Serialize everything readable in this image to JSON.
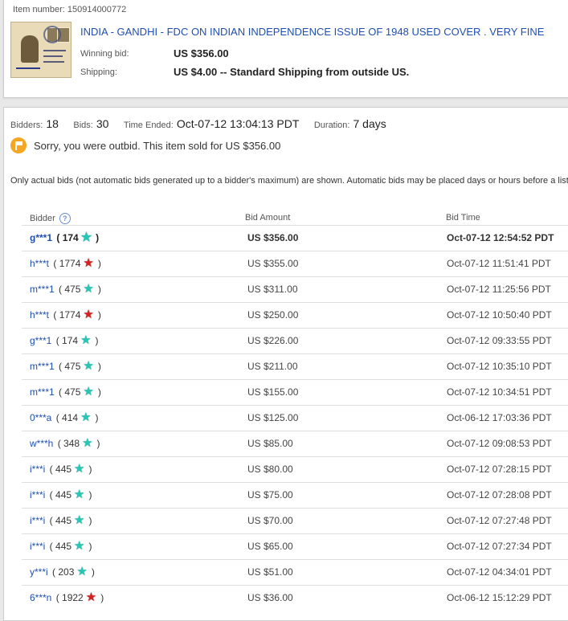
{
  "item": {
    "number_label": "Item number: 150914000772",
    "title": "INDIA - GANDHI - FDC ON INDIAN INDEPENDENCE ISSUE OF 1948 USED COVER . VERY FINE",
    "winning_bid_label": "Winning bid:",
    "winning_bid_value": "US $356.00",
    "shipping_label": "Shipping:",
    "shipping_value": "US $4.00 -- Standard Shipping from outside US."
  },
  "stats": {
    "bidders_label": "Bidders:",
    "bidders_value": "18",
    "bids_label": "Bids:",
    "bids_value": "30",
    "time_ended_label": "Time Ended:",
    "time_ended_value": "Oct-07-12 13:04:13 PDT",
    "duration_label": "Duration:",
    "duration_value": "7 days"
  },
  "alert": {
    "icon": "flag-icon",
    "color": "#f5a623",
    "text": "Sorry, you were outbid. This item sold for US $356.00"
  },
  "note": "Only actual bids (not automatic bids generated up to a bidder's maximum) are shown. Automatic bids may be placed days or hours before a listin",
  "table": {
    "headers": {
      "bidder": "Bidder",
      "amount": "Bid Amount",
      "time": "Bid Time"
    },
    "rows": [
      {
        "bidder": "g***1",
        "score": "174",
        "star": "teal",
        "amount": "US $356.00",
        "time": "Oct-07-12 12:54:52 PDT",
        "winner": true
      },
      {
        "bidder": "h***t",
        "score": "1774",
        "star": "red",
        "amount": "US $355.00",
        "time": "Oct-07-12 11:51:41 PDT"
      },
      {
        "bidder": "m***1",
        "score": "475",
        "star": "teal",
        "amount": "US $311.00",
        "time": "Oct-07-12 11:25:56 PDT"
      },
      {
        "bidder": "h***t",
        "score": "1774",
        "star": "red",
        "amount": "US $250.00",
        "time": "Oct-07-12 10:50:40 PDT"
      },
      {
        "bidder": "g***1",
        "score": "174",
        "star": "teal",
        "amount": "US $226.00",
        "time": "Oct-07-12 09:33:55 PDT"
      },
      {
        "bidder": "m***1",
        "score": "475",
        "star": "teal",
        "amount": "US $211.00",
        "time": "Oct-07-12 10:35:10 PDT"
      },
      {
        "bidder": "m***1",
        "score": "475",
        "star": "teal",
        "amount": "US $155.00",
        "time": "Oct-07-12 10:34:51 PDT"
      },
      {
        "bidder": "0***a",
        "score": "414",
        "star": "teal",
        "amount": "US $125.00",
        "time": "Oct-06-12 17:03:36 PDT"
      },
      {
        "bidder": "w***h",
        "score": "348",
        "star": "teal",
        "amount": "US $85.00",
        "time": "Oct-07-12 09:08:53 PDT"
      },
      {
        "bidder": "i***i",
        "score": "445",
        "star": "teal",
        "amount": "US $80.00",
        "time": "Oct-07-12 07:28:15 PDT"
      },
      {
        "bidder": "i***i",
        "score": "445",
        "star": "teal",
        "amount": "US $75.00",
        "time": "Oct-07-12 07:28:08 PDT"
      },
      {
        "bidder": "i***i",
        "score": "445",
        "star": "teal",
        "amount": "US $70.00",
        "time": "Oct-07-12 07:27:48 PDT"
      },
      {
        "bidder": "i***i",
        "score": "445",
        "star": "teal",
        "amount": "US $65.00",
        "time": "Oct-07-12 07:27:34 PDT"
      },
      {
        "bidder": "y***i",
        "score": "203",
        "star": "teal",
        "amount": "US $51.00",
        "time": "Oct-07-12 04:34:01 PDT"
      },
      {
        "bidder": "6***n",
        "score": "1922",
        "star": "red",
        "amount": "US $36.00",
        "time": "Oct-06-12 15:12:29 PDT"
      }
    ]
  }
}
